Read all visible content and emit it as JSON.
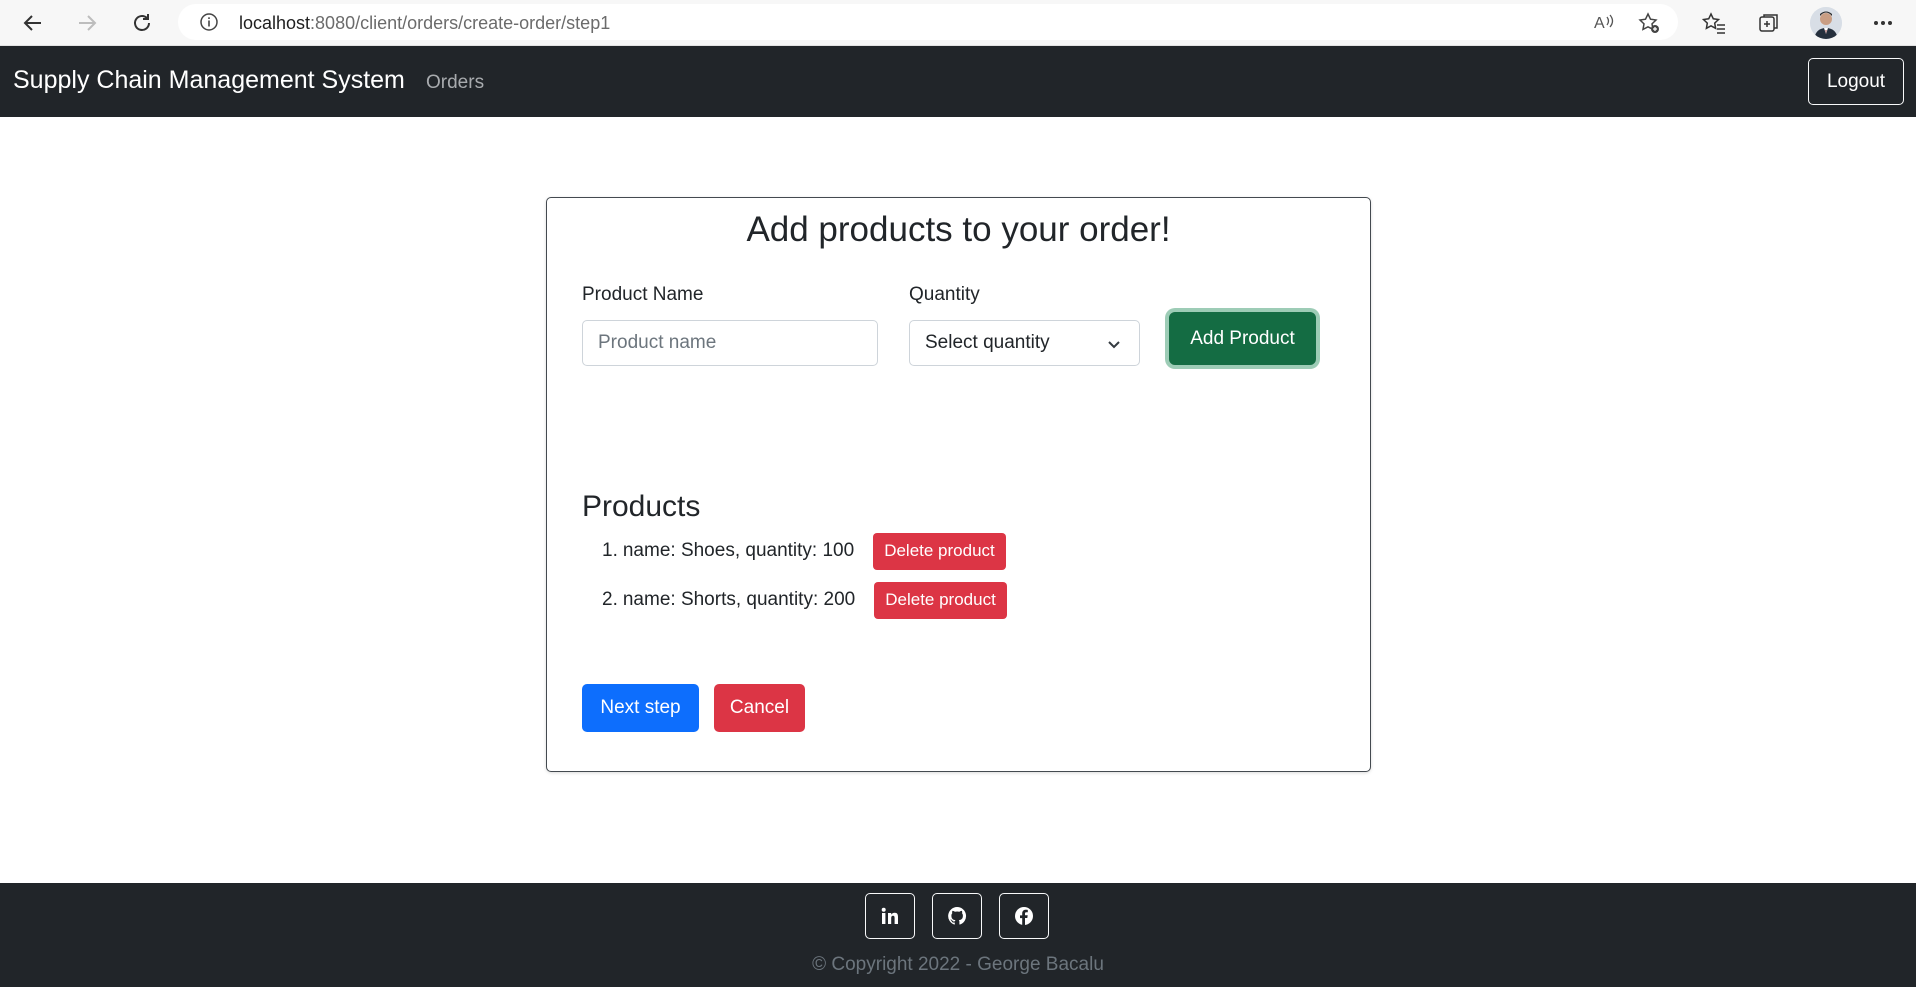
{
  "browser": {
    "url_host": "localhost",
    "url_path": ":8080/client/orders/create-order/step1",
    "icons": [
      "back-icon",
      "forward-icon",
      "reload-icon",
      "info-icon",
      "read-aloud-icon",
      "add-favorite-icon",
      "favorites-icon",
      "collections-icon",
      "profile-avatar",
      "more-icon"
    ]
  },
  "navbar": {
    "brand": "Supply Chain Management System",
    "orders_link": "Orders",
    "logout_label": "Logout"
  },
  "form": {
    "title": "Add products to your order!",
    "product_name_label": "Product Name",
    "product_name_placeholder": "Product name",
    "product_name_value": "",
    "quantity_label": "Quantity",
    "quantity_selected": "Select quantity",
    "add_button": "Add Product"
  },
  "products": {
    "heading": "Products",
    "items": [
      {
        "index": "1.",
        "text": "name: Shoes, quantity: 100",
        "delete_label": "Delete product"
      },
      {
        "index": "2.",
        "text": "name: Shorts, quantity: 200",
        "delete_label": "Delete product"
      }
    ]
  },
  "actions": {
    "next_label": "Next step",
    "cancel_label": "Cancel"
  },
  "footer": {
    "social": [
      "linkedin-icon",
      "github-icon",
      "facebook-icon"
    ],
    "copyright": "© Copyright 2022 - George Bacalu"
  },
  "colors": {
    "navbar_bg": "#212529",
    "success": "#146c43",
    "danger": "#dc3545",
    "primary": "#0d6efd"
  }
}
